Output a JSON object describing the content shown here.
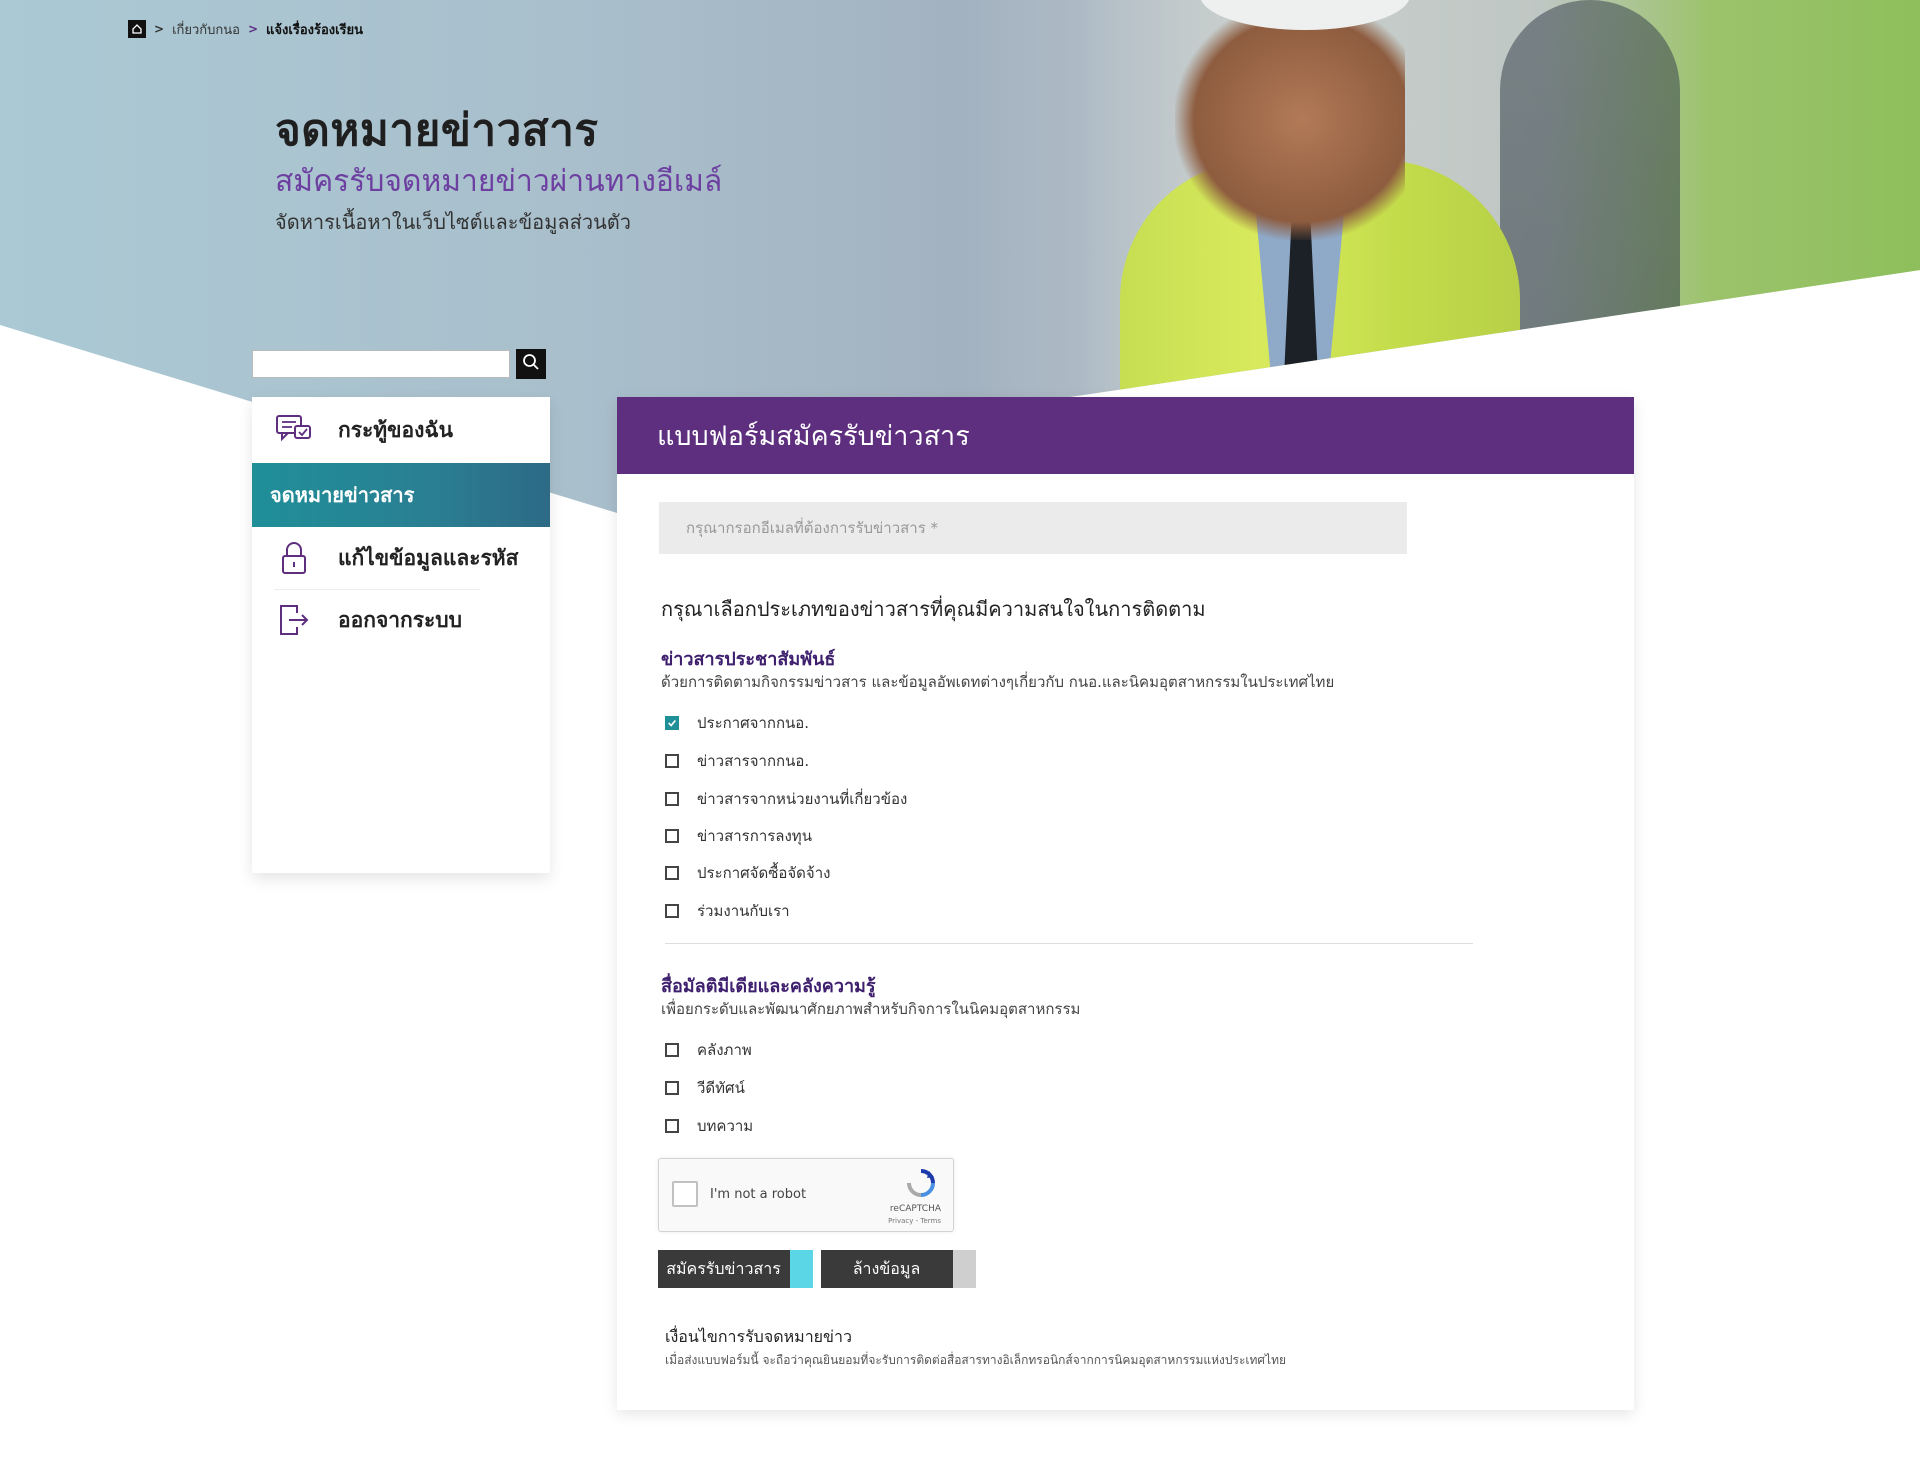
{
  "breadcrumb": {
    "items": [
      "เกี่ยวกับกนอ",
      "แจ้งเรื่องร้องเรียน"
    ]
  },
  "hero": {
    "title": "จดหมายข่าวสาร",
    "subtitle": "สมัครรับจดหมายข่าวผ่านทางอีเมล์",
    "description": "จัดหารเนื้อหาในเว็บไซต์และข้อมูลส่วนตัว"
  },
  "search": {
    "placeholder": "",
    "icon": "search-icon"
  },
  "sidebar": {
    "items": [
      {
        "label": "กระทู้ของฉัน",
        "icon": "chat-icon",
        "active": false
      },
      {
        "label": "จดหมายข่าวสาร",
        "icon": "",
        "active": true
      },
      {
        "label": "แก้ไขข้อมูลและรหัส",
        "icon": "lock-icon",
        "active": false
      },
      {
        "label": "ออกจากระบบ",
        "icon": "logout-icon",
        "active": false
      }
    ]
  },
  "form": {
    "header": "แบบฟอร์มสมัครรับข่าวสาร",
    "email_placeholder": "กรุณากรอกอีเมลที่ต้องการรับข่าวสาร *",
    "question": "กรุณาเลือกประเภทของข่าวสารที่คุณมีความสนใจในการติดตาม",
    "groups": [
      {
        "title": "ข่าวสารประชาสัมพันธ์",
        "desc": "ด้วยการติดตามกิจกรรมข่าวสาร และข้อมูลอัพเดทต่างๆเกี่ยวกับ กนอ.และนิคมอุตสาหกรรมในประเทศไทย",
        "options": [
          {
            "label": "ประกาศจากกนอ.",
            "checked": true
          },
          {
            "label": "ข่าวสารจากกนอ.",
            "checked": false
          },
          {
            "label": "ข่าวสารจากหน่วยงานที่เกี่ยวข้อง",
            "checked": false
          },
          {
            "label": "ข่าวสารการลงทุน",
            "checked": false
          },
          {
            "label": "ประกาศจัดซื้อจัดจ้าง",
            "checked": false
          },
          {
            "label": "ร่วมงานกับเรา",
            "checked": false
          }
        ]
      },
      {
        "title": "สื่อมัลติมีเดียและคลังความรู้",
        "desc": "เพื่อยกระดับและพัฒนาศักยภาพสำหรับกิจการในนิคมอุตสาหกรรม",
        "options": [
          {
            "label": "คลังภาพ",
            "checked": false
          },
          {
            "label": "วีดีทัศน์",
            "checked": false
          },
          {
            "label": "บทความ",
            "checked": false
          }
        ]
      }
    ],
    "captcha": {
      "label": "I'm not a robot",
      "brand": "reCAPTCHA",
      "terms": "Privacy - Terms"
    },
    "submit_label": "สมัครรับข่าวสาร",
    "clear_label": "ล้างข้อมูล",
    "terms_title": "เงื่อนไขการรับจดหมายข่าว",
    "terms_text": "เมื่อส่งแบบฟอร์มนี้ จะถือว่าคุณยินยอมที่จะรับการติดต่อสื่อสารทางอิเล็กทรอนิกส์จากการนิคมอุตสาหกรรมแห่งประเทศไทย"
  },
  "colors": {
    "accent_purple": "#5e2f7f",
    "accent_teal": "#1f8f98",
    "subtitle_purple": "#6c3fa0"
  }
}
